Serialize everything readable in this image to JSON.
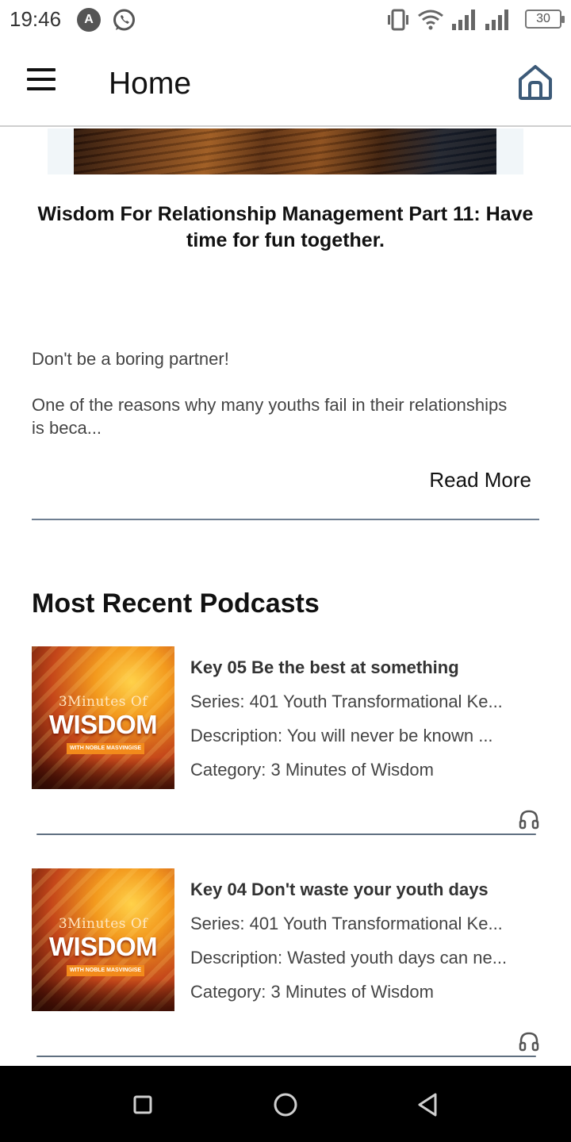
{
  "status_bar": {
    "time": "19:46",
    "battery": "30",
    "icons": [
      "app-a-icon",
      "whatsapp-icon",
      "vibrate-icon",
      "wifi-icon",
      "signal-icon",
      "signal-icon",
      "battery-icon"
    ]
  },
  "app_bar": {
    "title": "Home",
    "menu_icon": "hamburger-menu-icon",
    "home_icon": "home-icon"
  },
  "post": {
    "title": "Wisdom For Relationship Management Part 11: Have time for fun together.",
    "lead": "Don't be a boring partner!",
    "excerpt": "One of the reasons why many youths fail in their relationships is beca...",
    "read_more": "Read More"
  },
  "section": {
    "title": "Most Recent Podcasts"
  },
  "cover_art": {
    "line1": "3Minutes Of",
    "line2": "WISDOM",
    "tag": "WITH NOBLE MASVINGISE"
  },
  "podcasts": [
    {
      "title": "Key 05 Be the best at something",
      "series": "Series: 401 Youth Transformational Ke...",
      "description": "Description: You will never be known ...",
      "category": "Category: 3 Minutes of Wisdom"
    },
    {
      "title": "Key 04 Don't waste your youth days",
      "series": "Series: 401 Youth Transformational Ke...",
      "description": "Description: Wasted youth days can ne...",
      "category": "Category: 3 Minutes of Wisdom"
    }
  ],
  "nav_bar": {
    "buttons": [
      "recents-square-icon",
      "home-circle-icon",
      "back-triangle-icon"
    ]
  },
  "colors": {
    "divider": "#6f7f92",
    "home_icon": "#3c5a78",
    "accent_cover": "#f28a1b"
  }
}
